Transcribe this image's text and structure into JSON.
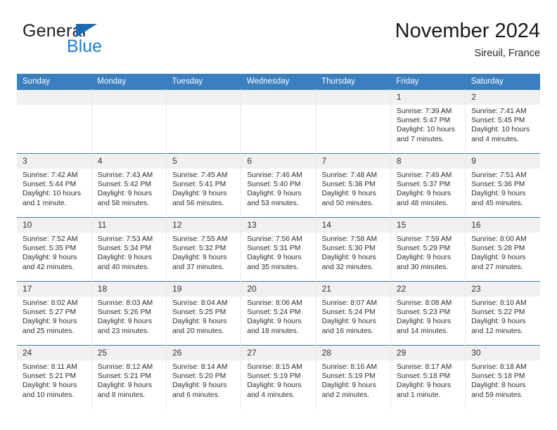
{
  "brand": {
    "name_part1": "General",
    "name_part2": "Blue",
    "triangle_color": "#1b6cb5",
    "blue_color": "#1b7fd4"
  },
  "header": {
    "title": "November 2024",
    "location": "Sireuil, France"
  },
  "theme": {
    "header_bg": "#3a7fbf",
    "daynum_bg": "#f0f0f0",
    "cell_bg": "#ffffff",
    "text": "#2d2d2d"
  },
  "weekday_headers": [
    "Sunday",
    "Monday",
    "Tuesday",
    "Wednesday",
    "Thursday",
    "Friday",
    "Saturday"
  ],
  "weeks": [
    [
      {
        "day": "",
        "lines": []
      },
      {
        "day": "",
        "lines": []
      },
      {
        "day": "",
        "lines": []
      },
      {
        "day": "",
        "lines": []
      },
      {
        "day": "",
        "lines": []
      },
      {
        "day": "1",
        "lines": [
          "Sunrise: 7:39 AM",
          "Sunset: 5:47 PM",
          "Daylight: 10 hours",
          "and 7 minutes."
        ]
      },
      {
        "day": "2",
        "lines": [
          "Sunrise: 7:41 AM",
          "Sunset: 5:45 PM",
          "Daylight: 10 hours",
          "and 4 minutes."
        ]
      }
    ],
    [
      {
        "day": "3",
        "lines": [
          "Sunrise: 7:42 AM",
          "Sunset: 5:44 PM",
          "Daylight: 10 hours",
          "and 1 minute."
        ]
      },
      {
        "day": "4",
        "lines": [
          "Sunrise: 7:43 AM",
          "Sunset: 5:42 PM",
          "Daylight: 9 hours",
          "and 58 minutes."
        ]
      },
      {
        "day": "5",
        "lines": [
          "Sunrise: 7:45 AM",
          "Sunset: 5:41 PM",
          "Daylight: 9 hours",
          "and 56 minutes."
        ]
      },
      {
        "day": "6",
        "lines": [
          "Sunrise: 7:46 AM",
          "Sunset: 5:40 PM",
          "Daylight: 9 hours",
          "and 53 minutes."
        ]
      },
      {
        "day": "7",
        "lines": [
          "Sunrise: 7:48 AM",
          "Sunset: 5:38 PM",
          "Daylight: 9 hours",
          "and 50 minutes."
        ]
      },
      {
        "day": "8",
        "lines": [
          "Sunrise: 7:49 AM",
          "Sunset: 5:37 PM",
          "Daylight: 9 hours",
          "and 48 minutes."
        ]
      },
      {
        "day": "9",
        "lines": [
          "Sunrise: 7:51 AM",
          "Sunset: 5:36 PM",
          "Daylight: 9 hours",
          "and 45 minutes."
        ]
      }
    ],
    [
      {
        "day": "10",
        "lines": [
          "Sunrise: 7:52 AM",
          "Sunset: 5:35 PM",
          "Daylight: 9 hours",
          "and 42 minutes."
        ]
      },
      {
        "day": "11",
        "lines": [
          "Sunrise: 7:53 AM",
          "Sunset: 5:34 PM",
          "Daylight: 9 hours",
          "and 40 minutes."
        ]
      },
      {
        "day": "12",
        "lines": [
          "Sunrise: 7:55 AM",
          "Sunset: 5:32 PM",
          "Daylight: 9 hours",
          "and 37 minutes."
        ]
      },
      {
        "day": "13",
        "lines": [
          "Sunrise: 7:56 AM",
          "Sunset: 5:31 PM",
          "Daylight: 9 hours",
          "and 35 minutes."
        ]
      },
      {
        "day": "14",
        "lines": [
          "Sunrise: 7:58 AM",
          "Sunset: 5:30 PM",
          "Daylight: 9 hours",
          "and 32 minutes."
        ]
      },
      {
        "day": "15",
        "lines": [
          "Sunrise: 7:59 AM",
          "Sunset: 5:29 PM",
          "Daylight: 9 hours",
          "and 30 minutes."
        ]
      },
      {
        "day": "16",
        "lines": [
          "Sunrise: 8:00 AM",
          "Sunset: 5:28 PM",
          "Daylight: 9 hours",
          "and 27 minutes."
        ]
      }
    ],
    [
      {
        "day": "17",
        "lines": [
          "Sunrise: 8:02 AM",
          "Sunset: 5:27 PM",
          "Daylight: 9 hours",
          "and 25 minutes."
        ]
      },
      {
        "day": "18",
        "lines": [
          "Sunrise: 8:03 AM",
          "Sunset: 5:26 PM",
          "Daylight: 9 hours",
          "and 23 minutes."
        ]
      },
      {
        "day": "19",
        "lines": [
          "Sunrise: 8:04 AM",
          "Sunset: 5:25 PM",
          "Daylight: 9 hours",
          "and 20 minutes."
        ]
      },
      {
        "day": "20",
        "lines": [
          "Sunrise: 8:06 AM",
          "Sunset: 5:24 PM",
          "Daylight: 9 hours",
          "and 18 minutes."
        ]
      },
      {
        "day": "21",
        "lines": [
          "Sunrise: 8:07 AM",
          "Sunset: 5:24 PM",
          "Daylight: 9 hours",
          "and 16 minutes."
        ]
      },
      {
        "day": "22",
        "lines": [
          "Sunrise: 8:08 AM",
          "Sunset: 5:23 PM",
          "Daylight: 9 hours",
          "and 14 minutes."
        ]
      },
      {
        "day": "23",
        "lines": [
          "Sunrise: 8:10 AM",
          "Sunset: 5:22 PM",
          "Daylight: 9 hours",
          "and 12 minutes."
        ]
      }
    ],
    [
      {
        "day": "24",
        "lines": [
          "Sunrise: 8:11 AM",
          "Sunset: 5:21 PM",
          "Daylight: 9 hours",
          "and 10 minutes."
        ]
      },
      {
        "day": "25",
        "lines": [
          "Sunrise: 8:12 AM",
          "Sunset: 5:21 PM",
          "Daylight: 9 hours",
          "and 8 minutes."
        ]
      },
      {
        "day": "26",
        "lines": [
          "Sunrise: 8:14 AM",
          "Sunset: 5:20 PM",
          "Daylight: 9 hours",
          "and 6 minutes."
        ]
      },
      {
        "day": "27",
        "lines": [
          "Sunrise: 8:15 AM",
          "Sunset: 5:19 PM",
          "Daylight: 9 hours",
          "and 4 minutes."
        ]
      },
      {
        "day": "28",
        "lines": [
          "Sunrise: 8:16 AM",
          "Sunset: 5:19 PM",
          "Daylight: 9 hours",
          "and 2 minutes."
        ]
      },
      {
        "day": "29",
        "lines": [
          "Sunrise: 8:17 AM",
          "Sunset: 5:18 PM",
          "Daylight: 9 hours",
          "and 1 minute."
        ]
      },
      {
        "day": "30",
        "lines": [
          "Sunrise: 8:18 AM",
          "Sunset: 5:18 PM",
          "Daylight: 8 hours",
          "and 59 minutes."
        ]
      }
    ]
  ]
}
